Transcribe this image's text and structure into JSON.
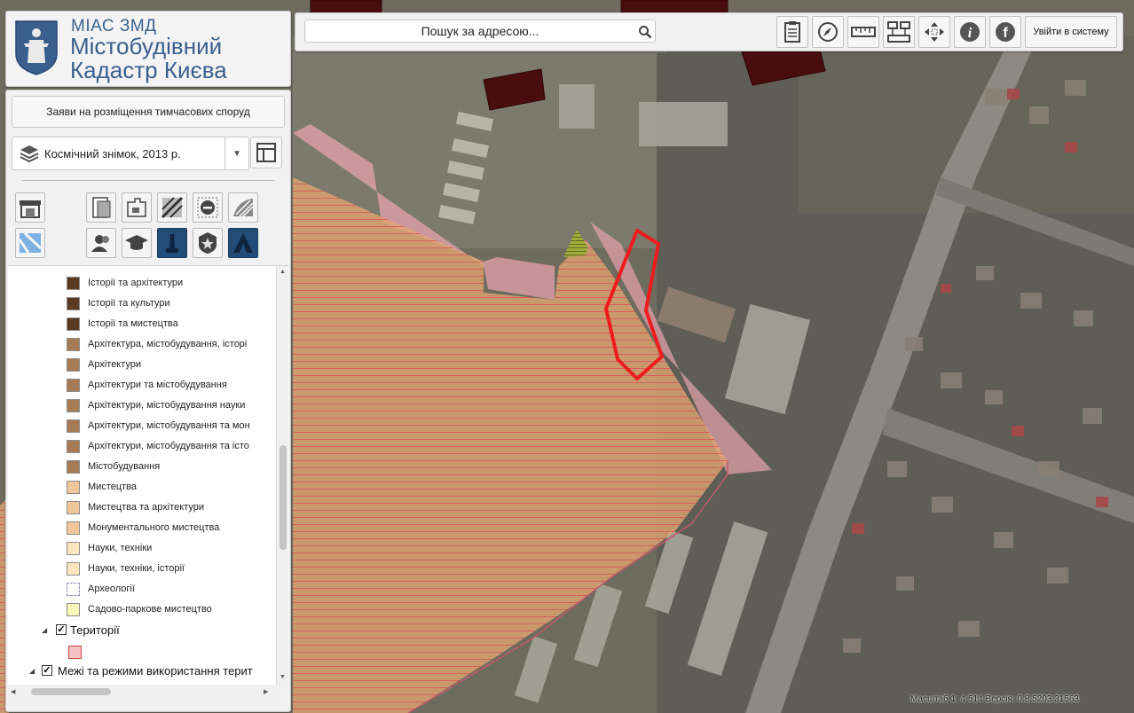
{
  "logo": {
    "line1": "МІАС ЗМД",
    "line2": "Містобудівний",
    "line3": "Кадастр Києва"
  },
  "panel": {
    "request_button": "Заяви на розміщення тимчасових споруд",
    "basemap_label": "Космічний знімок, 2013 р."
  },
  "tools_row1": [
    "kiosk-icon",
    "document-layers-icon",
    "puzzle-icon",
    "grid-overlay-icon",
    "stop-sign-icon",
    "hatched-area-icon"
  ],
  "tools_row2": [
    "map-icon",
    "users-icon",
    "graduation-cap-icon",
    "monument-icon",
    "police-badge-icon",
    "tent-icon"
  ],
  "legend": {
    "items": [
      {
        "label": "Історії та архітектури",
        "color": "#5a3a22"
      },
      {
        "label": "Історії та культури",
        "color": "#5a3a22"
      },
      {
        "label": "Історії та мистецтва",
        "color": "#5a3a22"
      },
      {
        "label": "Архітектура, містобудування, історі",
        "color": "#a67b56"
      },
      {
        "label": "Архітектури",
        "color": "#a67b56"
      },
      {
        "label": "Архітектури та містобудування",
        "color": "#a67b56"
      },
      {
        "label": "Архітектури, містобудування науки",
        "color": "#a67b56"
      },
      {
        "label": "Архітектури, містобудування та мон",
        "color": "#a67b56"
      },
      {
        "label": "Архітектури, містобудування та істо",
        "color": "#a67b56"
      },
      {
        "label": "Містобудування",
        "color": "#a67b56"
      },
      {
        "label": "Мистецтва",
        "color": "#f0c79a"
      },
      {
        "label": "Мистецтва та архітектури",
        "color": "#f0c79a"
      },
      {
        "label": "Монументального мистецтва",
        "color": "#f0c79a"
      },
      {
        "label": "Науки, техніки",
        "color": "#fbe6c0"
      },
      {
        "label": "Науки, техніки, історії",
        "color": "#fbe6c0"
      },
      {
        "label": "Археології",
        "color": "#ffffff"
      },
      {
        "label": "Садово-паркове мистецтво",
        "color": "#f6f9b8"
      }
    ],
    "group_territories": "Території",
    "territories_color": "#f4c4c4",
    "group_boundaries": "Межі та режими використання терит"
  },
  "toolbar": {
    "search_placeholder": "Пошук за адресою...",
    "tools": [
      "clipboard-icon",
      "compass-icon",
      "ruler-icon",
      "diagram-icon",
      "move-icon",
      "info-icon",
      "facebook-icon"
    ],
    "login_label": "Увійти в систему"
  },
  "scale_text": "Масштаб 1: 4 514 Версія: 0.8.5203.31563",
  "colors": {
    "zone_fill": "#e8a66b",
    "zone_pink": "#e8a0a8",
    "highlight": "#ee1c1c",
    "brand_blue": "#3a5f8f"
  }
}
